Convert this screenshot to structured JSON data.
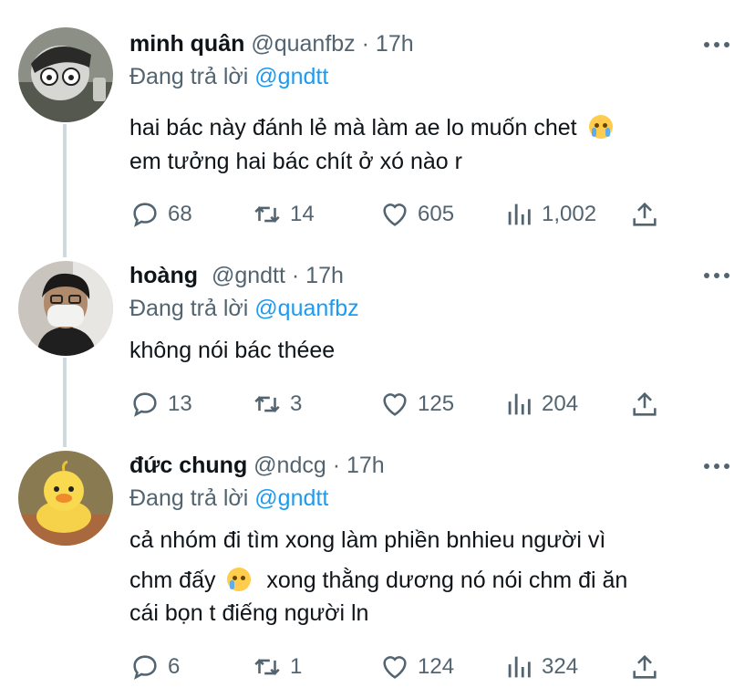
{
  "tweets": [
    {
      "name": "minh quân",
      "handle": "@quanfbz",
      "dot": "·",
      "time": "17h",
      "reply_prefix": "Đang trả lời",
      "reply_to": "@gndtt",
      "lines": [
        "hai bác này đánh lẻ mà làm ae lo muốn chet",
        "em tưởng hai bác chít ở xó nào r"
      ],
      "replies": "68",
      "retweets": "14",
      "likes": "605",
      "views": "1,002"
    },
    {
      "name": "hoàng",
      "handle": "@gndtt",
      "dot": "·",
      "time": "17h",
      "reply_prefix": "Đang trả lời",
      "reply_to": "@quanfbz",
      "lines": [
        "không nói bác théee"
      ],
      "replies": "13",
      "retweets": "3",
      "likes": "125",
      "views": "204"
    },
    {
      "name": "đức chung",
      "handle": "@ndcg",
      "dot": "·",
      "time": "17h",
      "reply_prefix": "Đang trả lời",
      "reply_to": "@gndtt",
      "lines": [
        "cả nhóm đi tìm xong làm phiền bnhieu người vì",
        "chm đấy",
        "xong thằng dương nó nói chm đi ăn",
        "cái bọn t điếng người ln"
      ],
      "replies": "6",
      "retweets": "1",
      "likes": "124",
      "views": "324"
    }
  ],
  "icons": {
    "reply": "speech-bubble-icon",
    "retweet": "retweet-arrows-icon",
    "like": "heart-icon",
    "views": "bar-chart-icon",
    "share": "share-upload-icon",
    "more": "more-dots-icon"
  },
  "colors": {
    "text": "#0f1419",
    "secondary": "#536471",
    "accent": "#1d9bf0",
    "thread_line": "#cfd9de"
  }
}
